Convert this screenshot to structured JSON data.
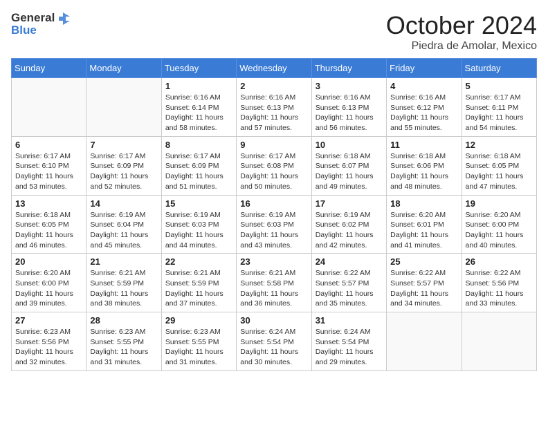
{
  "logo": {
    "general": "General",
    "blue": "Blue"
  },
  "title": "October 2024",
  "location": "Piedra de Amolar, Mexico",
  "weekdays": [
    "Sunday",
    "Monday",
    "Tuesday",
    "Wednesday",
    "Thursday",
    "Friday",
    "Saturday"
  ],
  "weeks": [
    [
      {
        "day": "",
        "info": ""
      },
      {
        "day": "",
        "info": ""
      },
      {
        "day": "1",
        "info": "Sunrise: 6:16 AM\nSunset: 6:14 PM\nDaylight: 11 hours and 58 minutes."
      },
      {
        "day": "2",
        "info": "Sunrise: 6:16 AM\nSunset: 6:13 PM\nDaylight: 11 hours and 57 minutes."
      },
      {
        "day": "3",
        "info": "Sunrise: 6:16 AM\nSunset: 6:13 PM\nDaylight: 11 hours and 56 minutes."
      },
      {
        "day": "4",
        "info": "Sunrise: 6:16 AM\nSunset: 6:12 PM\nDaylight: 11 hours and 55 minutes."
      },
      {
        "day": "5",
        "info": "Sunrise: 6:17 AM\nSunset: 6:11 PM\nDaylight: 11 hours and 54 minutes."
      }
    ],
    [
      {
        "day": "6",
        "info": "Sunrise: 6:17 AM\nSunset: 6:10 PM\nDaylight: 11 hours and 53 minutes."
      },
      {
        "day": "7",
        "info": "Sunrise: 6:17 AM\nSunset: 6:09 PM\nDaylight: 11 hours and 52 minutes."
      },
      {
        "day": "8",
        "info": "Sunrise: 6:17 AM\nSunset: 6:09 PM\nDaylight: 11 hours and 51 minutes."
      },
      {
        "day": "9",
        "info": "Sunrise: 6:17 AM\nSunset: 6:08 PM\nDaylight: 11 hours and 50 minutes."
      },
      {
        "day": "10",
        "info": "Sunrise: 6:18 AM\nSunset: 6:07 PM\nDaylight: 11 hours and 49 minutes."
      },
      {
        "day": "11",
        "info": "Sunrise: 6:18 AM\nSunset: 6:06 PM\nDaylight: 11 hours and 48 minutes."
      },
      {
        "day": "12",
        "info": "Sunrise: 6:18 AM\nSunset: 6:05 PM\nDaylight: 11 hours and 47 minutes."
      }
    ],
    [
      {
        "day": "13",
        "info": "Sunrise: 6:18 AM\nSunset: 6:05 PM\nDaylight: 11 hours and 46 minutes."
      },
      {
        "day": "14",
        "info": "Sunrise: 6:19 AM\nSunset: 6:04 PM\nDaylight: 11 hours and 45 minutes."
      },
      {
        "day": "15",
        "info": "Sunrise: 6:19 AM\nSunset: 6:03 PM\nDaylight: 11 hours and 44 minutes."
      },
      {
        "day": "16",
        "info": "Sunrise: 6:19 AM\nSunset: 6:03 PM\nDaylight: 11 hours and 43 minutes."
      },
      {
        "day": "17",
        "info": "Sunrise: 6:19 AM\nSunset: 6:02 PM\nDaylight: 11 hours and 42 minutes."
      },
      {
        "day": "18",
        "info": "Sunrise: 6:20 AM\nSunset: 6:01 PM\nDaylight: 11 hours and 41 minutes."
      },
      {
        "day": "19",
        "info": "Sunrise: 6:20 AM\nSunset: 6:00 PM\nDaylight: 11 hours and 40 minutes."
      }
    ],
    [
      {
        "day": "20",
        "info": "Sunrise: 6:20 AM\nSunset: 6:00 PM\nDaylight: 11 hours and 39 minutes."
      },
      {
        "day": "21",
        "info": "Sunrise: 6:21 AM\nSunset: 5:59 PM\nDaylight: 11 hours and 38 minutes."
      },
      {
        "day": "22",
        "info": "Sunrise: 6:21 AM\nSunset: 5:59 PM\nDaylight: 11 hours and 37 minutes."
      },
      {
        "day": "23",
        "info": "Sunrise: 6:21 AM\nSunset: 5:58 PM\nDaylight: 11 hours and 36 minutes."
      },
      {
        "day": "24",
        "info": "Sunrise: 6:22 AM\nSunset: 5:57 PM\nDaylight: 11 hours and 35 minutes."
      },
      {
        "day": "25",
        "info": "Sunrise: 6:22 AM\nSunset: 5:57 PM\nDaylight: 11 hours and 34 minutes."
      },
      {
        "day": "26",
        "info": "Sunrise: 6:22 AM\nSunset: 5:56 PM\nDaylight: 11 hours and 33 minutes."
      }
    ],
    [
      {
        "day": "27",
        "info": "Sunrise: 6:23 AM\nSunset: 5:56 PM\nDaylight: 11 hours and 32 minutes."
      },
      {
        "day": "28",
        "info": "Sunrise: 6:23 AM\nSunset: 5:55 PM\nDaylight: 11 hours and 31 minutes."
      },
      {
        "day": "29",
        "info": "Sunrise: 6:23 AM\nSunset: 5:55 PM\nDaylight: 11 hours and 31 minutes."
      },
      {
        "day": "30",
        "info": "Sunrise: 6:24 AM\nSunset: 5:54 PM\nDaylight: 11 hours and 30 minutes."
      },
      {
        "day": "31",
        "info": "Sunrise: 6:24 AM\nSunset: 5:54 PM\nDaylight: 11 hours and 29 minutes."
      },
      {
        "day": "",
        "info": ""
      },
      {
        "day": "",
        "info": ""
      }
    ]
  ]
}
